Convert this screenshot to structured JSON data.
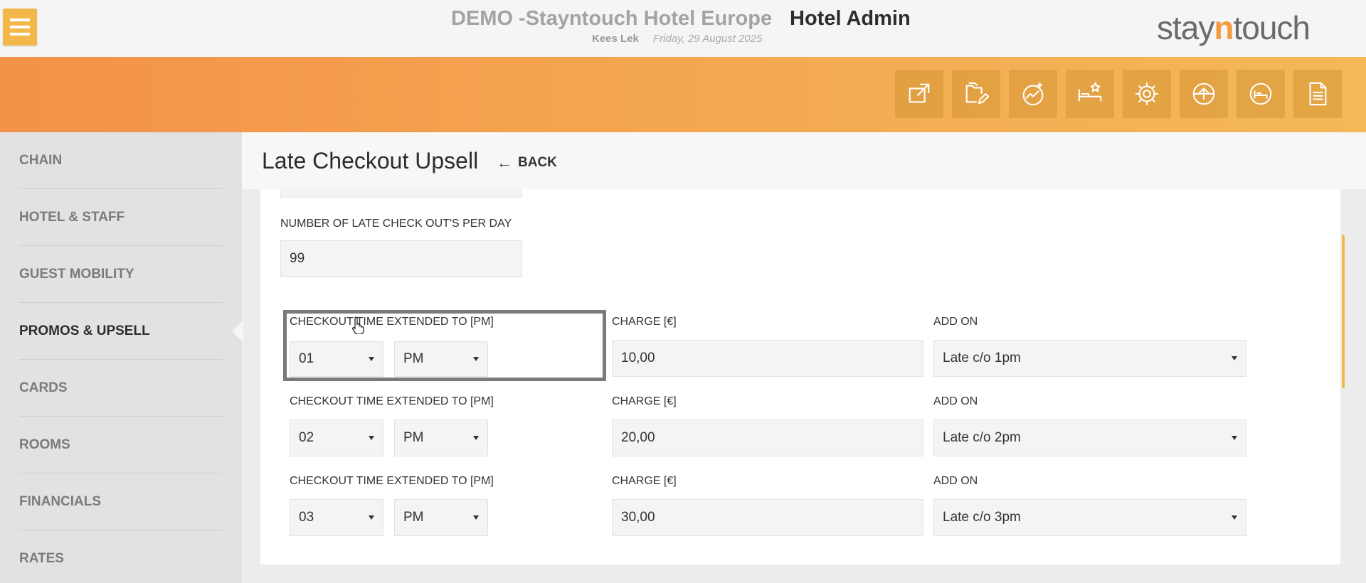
{
  "header": {
    "hotel_name": "DEMO -Stayntouch Hotel Europe",
    "app_title": "Hotel Admin",
    "user": "Kees Lek",
    "date": "Friday, 29 August 2025",
    "logo_part1": "stay",
    "logo_accent": "n",
    "logo_part2": "touch"
  },
  "toolbar": [
    {
      "icon": "external-link-icon"
    },
    {
      "icon": "folder-edit-icon"
    },
    {
      "icon": "stats-sparkle-icon"
    },
    {
      "icon": "bed-star-icon"
    },
    {
      "icon": "gear-icon"
    },
    {
      "icon": "upload-icon"
    },
    {
      "icon": "bed-refresh-icon"
    },
    {
      "icon": "document-icon"
    }
  ],
  "sidebar": {
    "items": [
      {
        "label": "CHAIN",
        "active": false
      },
      {
        "label": "HOTEL & STAFF",
        "active": false
      },
      {
        "label": "GUEST MOBILITY",
        "active": false
      },
      {
        "label": "PROMOS & UPSELL",
        "active": true
      },
      {
        "label": "CARDS",
        "active": false
      },
      {
        "label": "ROOMS",
        "active": false
      },
      {
        "label": "FINANCIALS",
        "active": false
      },
      {
        "label": "RATES",
        "active": false
      }
    ]
  },
  "page": {
    "title": "Late Checkout Upsell",
    "back_label": "BACK"
  },
  "form": {
    "per_day_label": "NUMBER OF LATE CHECK OUT'S PER DAY",
    "per_day_value": "99",
    "rows": [
      {
        "time_label": "CHECKOUT TIME EXTENDED TO [PM]",
        "hour": "01",
        "ampm": "PM",
        "charge_label": "CHARGE [€]",
        "charge": "10,00",
        "addon_label": "ADD ON",
        "addon": "Late c/o 1pm"
      },
      {
        "time_label": "CHECKOUT TIME EXTENDED TO [PM]",
        "hour": "02",
        "ampm": "PM",
        "charge_label": "CHARGE [€]",
        "charge": "20,00",
        "addon_label": "ADD ON",
        "addon": "Late c/o 2pm"
      },
      {
        "time_label": "CHECKOUT TIME EXTENDED TO [PM]",
        "hour": "03",
        "ampm": "PM",
        "charge_label": "CHARGE [€]",
        "charge": "30,00",
        "addon_label": "ADD ON",
        "addon": "Late c/o 3pm"
      }
    ]
  },
  "colors": {
    "accent": "#f3b84a",
    "band_start": "#f39248",
    "band_end": "#f4b857"
  }
}
